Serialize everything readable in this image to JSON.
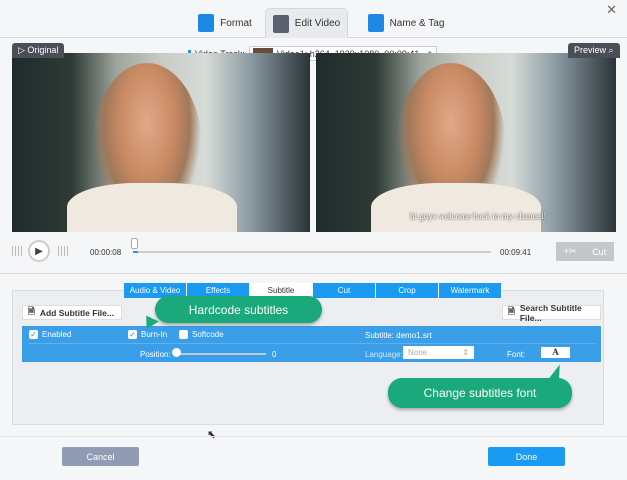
{
  "tabs": [
    {
      "label": "Format"
    },
    {
      "label": "Edit Video"
    },
    {
      "label": "Name & Tag"
    }
  ],
  "video_track": {
    "label": "Video Track:",
    "value": "Video1: h264, 1920x1080, 00:09:41"
  },
  "original_label": "Original",
  "preview_label": "Preview",
  "subtitle_overlay": "hi guys welcome back to my channel!",
  "player": {
    "current_time": "00:00:08",
    "total_time": "00:09:41",
    "progress": 0.014,
    "cut_label": "Cut"
  },
  "edit_tabs": [
    {
      "label": "Audio & Video"
    },
    {
      "label": "Effects"
    },
    {
      "label": "Subtitle"
    },
    {
      "label": "Cut"
    },
    {
      "label": "Crop"
    },
    {
      "label": "Watermark"
    }
  ],
  "subtitle": {
    "add_label": "Add Subtitle File...",
    "search_label": "Search Subtitle File...",
    "enabled_label": "Enabled",
    "enabled": true,
    "burnin_label": "Burn-In",
    "burnin": true,
    "softcode_label": "Softcode",
    "softcode": false,
    "file_label": "Subtitle: demo1.srt",
    "position_label": "Position:",
    "position_value": "0",
    "language_label": "Language:",
    "language_value": "None",
    "font_label": "Font:",
    "font_button": "A"
  },
  "callouts": {
    "hardcode": "Hardcode subtitles",
    "font": "Change subtitles font"
  },
  "footer": {
    "cancel": "Cancel",
    "done": "Done"
  }
}
